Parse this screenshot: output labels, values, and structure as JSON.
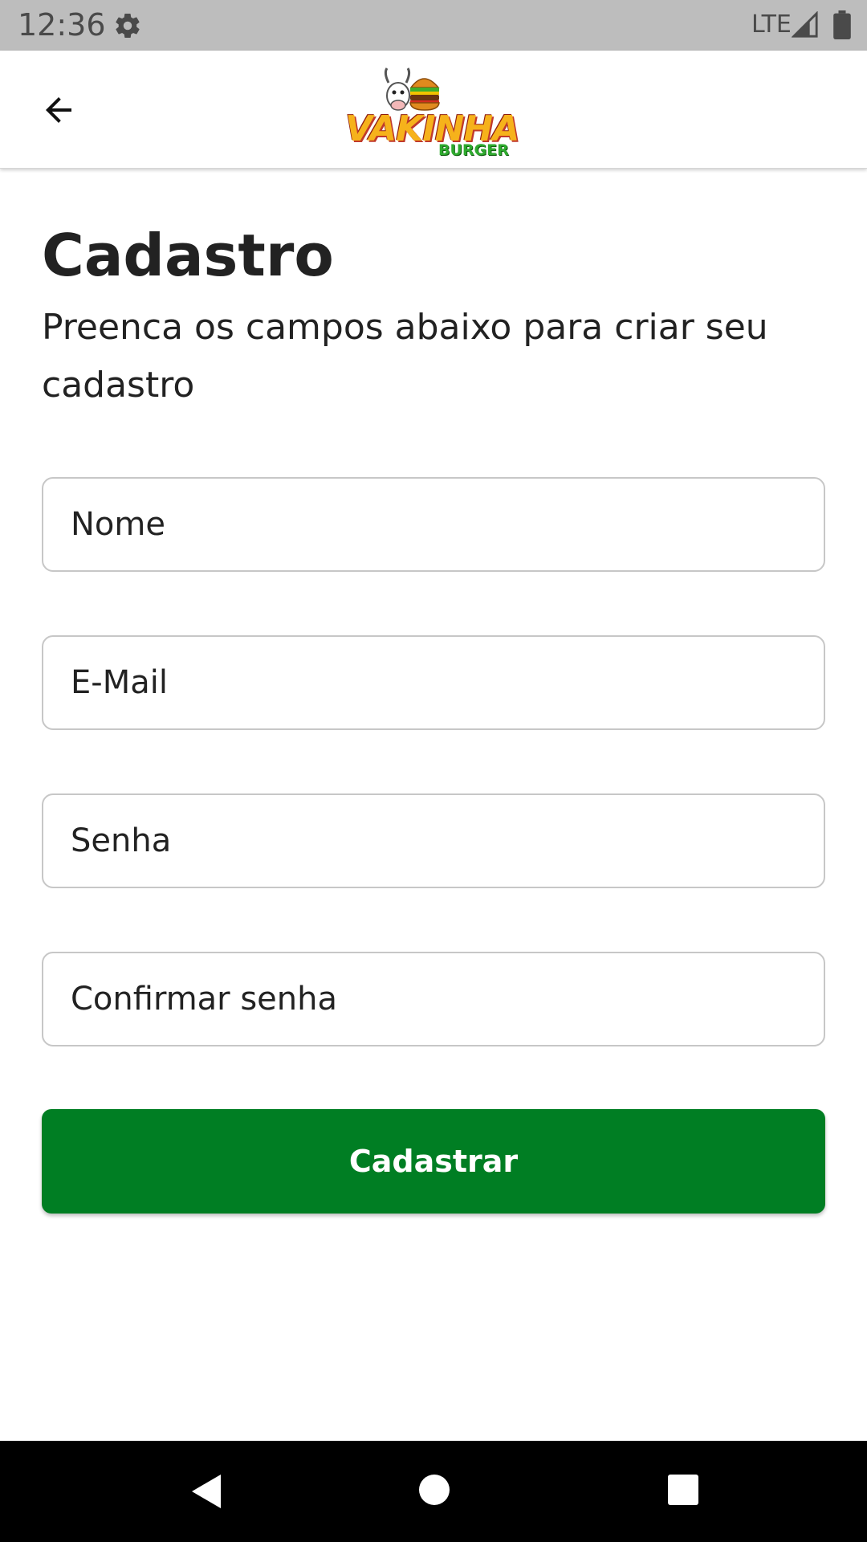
{
  "status_bar": {
    "time": "12:36",
    "network": "LTE",
    "icons": [
      "settings-gear-icon",
      "signal-icon",
      "battery-icon"
    ]
  },
  "app_bar": {
    "back_icon": "arrow-left-icon",
    "logo": {
      "name": "VAKINHA",
      "sub": "BURGER"
    }
  },
  "page": {
    "title": "Cadastro",
    "subtitle": "Preenca os campos abaixo para criar seu cadastro"
  },
  "form": {
    "name_placeholder": "Nome",
    "email_placeholder": "E-Mail",
    "password_placeholder": "Senha",
    "confirm_password_placeholder": "Confirmar senha",
    "submit_label": "Cadastrar"
  },
  "colors": {
    "primary": "#007e23",
    "status_bar": "#bdbdbd",
    "text": "#222222"
  },
  "nav_bar": {
    "icons": [
      "nav-back-icon",
      "nav-home-icon",
      "nav-recents-icon"
    ]
  }
}
